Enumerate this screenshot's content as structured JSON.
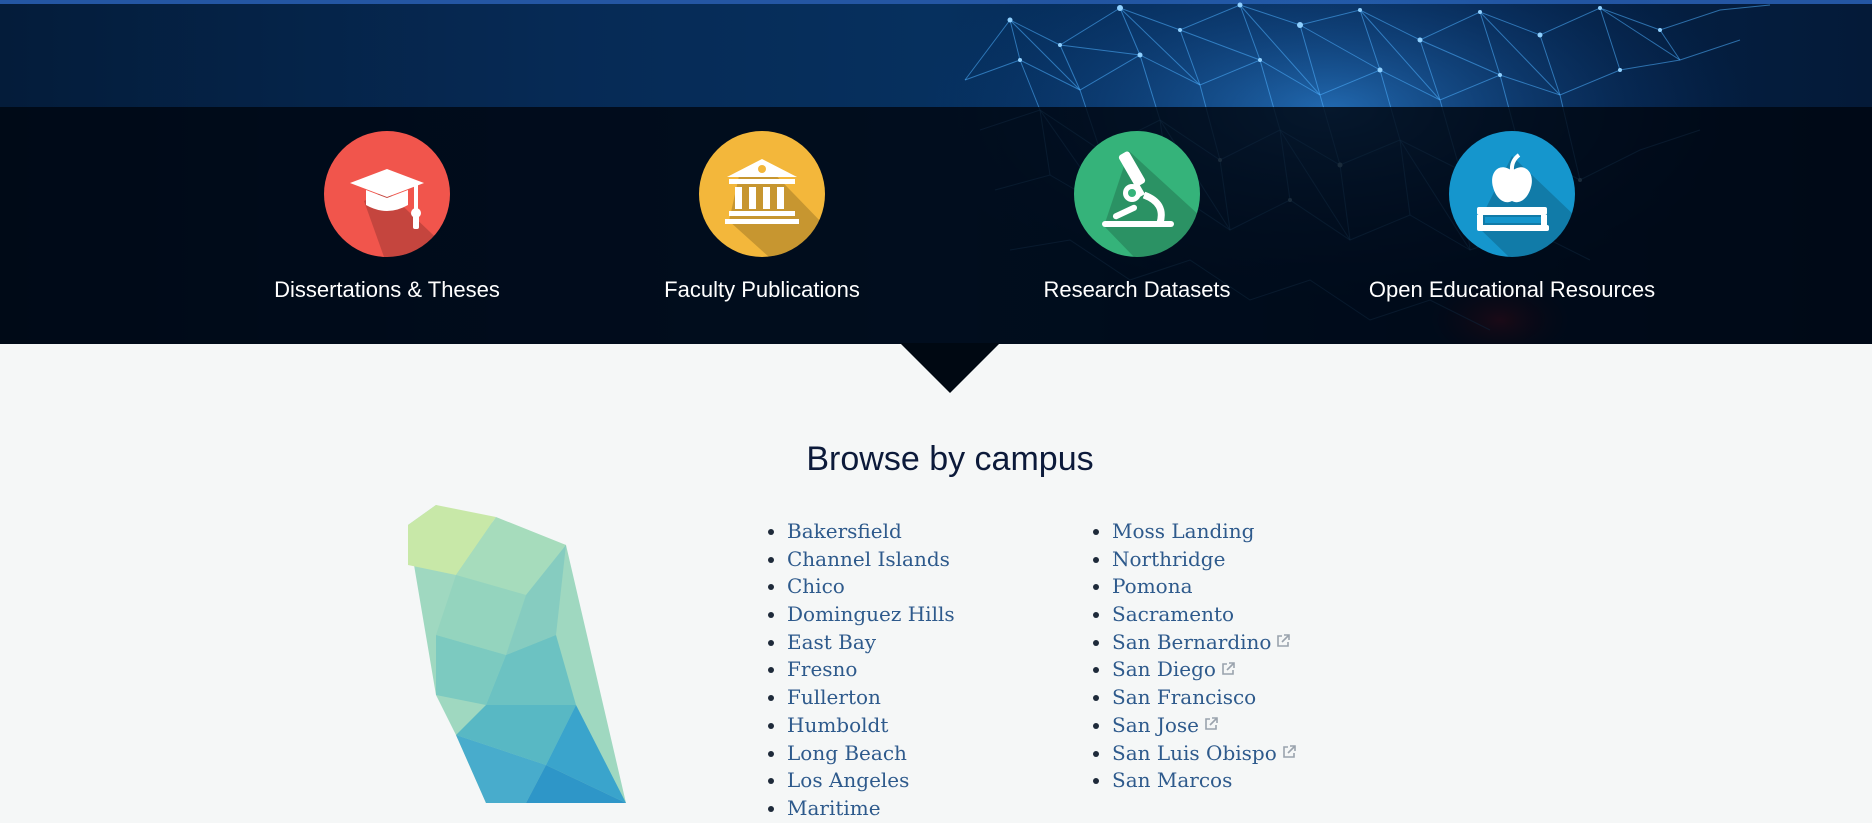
{
  "hero": {
    "categories": [
      {
        "label": "Dissertations & Theses",
        "icon": "graduation-cap-icon",
        "color": "#f1554c"
      },
      {
        "label": "Faculty Publications",
        "icon": "institution-icon",
        "color": "#f3b73b"
      },
      {
        "label": "Research Datasets",
        "icon": "microscope-icon",
        "color": "#35b37a"
      },
      {
        "label": "Open Educational Resources",
        "icon": "apple-book-icon",
        "color": "#1596cd"
      }
    ]
  },
  "browse": {
    "title": "Browse by campus",
    "campuses_left": [
      {
        "name": "Bakersfield",
        "external": false
      },
      {
        "name": "Channel Islands",
        "external": false
      },
      {
        "name": "Chico",
        "external": false
      },
      {
        "name": "Dominguez Hills",
        "external": false
      },
      {
        "name": "East Bay",
        "external": false
      },
      {
        "name": "Fresno",
        "external": false
      },
      {
        "name": "Fullerton",
        "external": false
      },
      {
        "name": "Humboldt",
        "external": false
      },
      {
        "name": "Long Beach",
        "external": false
      },
      {
        "name": "Los Angeles",
        "external": false
      },
      {
        "name": "Maritime",
        "external": false
      }
    ],
    "campuses_right": [
      {
        "name": "Moss Landing",
        "external": false
      },
      {
        "name": "Northridge",
        "external": false
      },
      {
        "name": "Pomona",
        "external": false
      },
      {
        "name": "Sacramento",
        "external": false
      },
      {
        "name": "San Bernardino",
        "external": true
      },
      {
        "name": "San Diego",
        "external": true
      },
      {
        "name": "San Francisco",
        "external": false
      },
      {
        "name": "San Jose",
        "external": true
      },
      {
        "name": "San Luis Obispo",
        "external": true
      },
      {
        "name": "San Marcos",
        "external": false
      }
    ],
    "link_color": "#2e5a8c",
    "map_icon": "california-map-icon"
  }
}
